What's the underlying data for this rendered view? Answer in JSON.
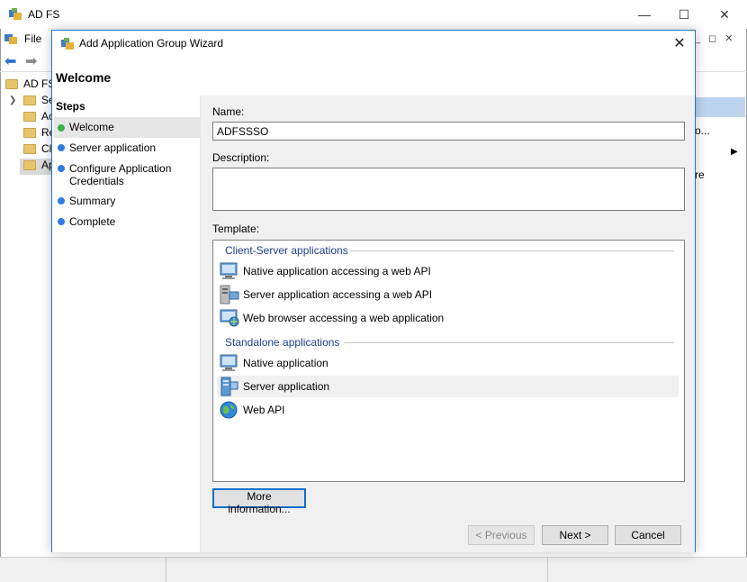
{
  "background_window": {
    "title": "AD FS",
    "menu_file": "File",
    "tree_root": "AD FS",
    "tree_items": [
      "Se",
      "Ac",
      "Re",
      "Cl",
      "Ap"
    ],
    "actions_item_1": "o...",
    "actions_item_2": "re"
  },
  "wizard": {
    "title": "Add Application Group Wizard",
    "heading": "Welcome",
    "steps_title": "Steps",
    "steps": [
      {
        "label": "Welcome",
        "status": "current"
      },
      {
        "label": "Server application",
        "status": "pending"
      },
      {
        "label": "Configure Application Credentials",
        "status": "pending"
      },
      {
        "label": "Summary",
        "status": "pending"
      },
      {
        "label": "Complete",
        "status": "pending"
      }
    ],
    "name_label": "Name:",
    "name_value": "ADFSSSO",
    "description_label": "Description:",
    "description_value": "",
    "template_label": "Template:",
    "template_groups": [
      {
        "title": "Client-Server applications",
        "items": [
          {
            "label": "Native application accessing a web API",
            "icon": "native-app-icon"
          },
          {
            "label": "Server application accessing a web API",
            "icon": "server-app-icon"
          },
          {
            "label": "Web browser accessing a web application",
            "icon": "web-browser-icon"
          }
        ]
      },
      {
        "title": "Standalone applications",
        "items": [
          {
            "label": "Native application",
            "icon": "native-app-icon"
          },
          {
            "label": "Server application",
            "icon": "server-app-icon",
            "selected": true
          },
          {
            "label": "Web API",
            "icon": "globe-icon"
          }
        ]
      }
    ],
    "more_info_button": "More information...",
    "previous_button": "< Previous",
    "next_button": "Next >",
    "cancel_button": "Cancel"
  },
  "colors": {
    "accent": "#1d78c9",
    "step_current": "#3cb34a",
    "step_pending": "#2f7be0",
    "group_header": "#1e3f8a"
  }
}
